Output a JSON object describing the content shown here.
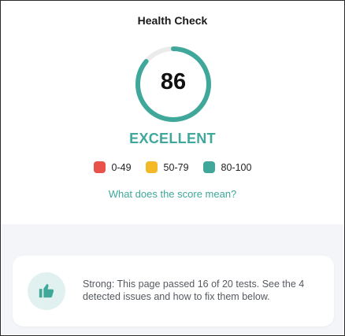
{
  "title": "Health Check",
  "score": {
    "value": "86",
    "fraction": 0.86,
    "rating": "EXCELLENT",
    "rating_color": "#3fa89a",
    "track_color": "#ebebeb"
  },
  "legend": [
    {
      "label": "0-49",
      "color": "#e8524a"
    },
    {
      "label": "50-79",
      "color": "#f3b927"
    },
    {
      "label": "80-100",
      "color": "#3fa89a"
    }
  ],
  "link": {
    "label": "What does the score mean?",
    "color": "#3fa89a"
  },
  "summary": {
    "icon": "thumbs-up-icon",
    "text": "Strong: This page passed 16 of 20 tests. See the 4 detected issues and how to fix them below."
  }
}
